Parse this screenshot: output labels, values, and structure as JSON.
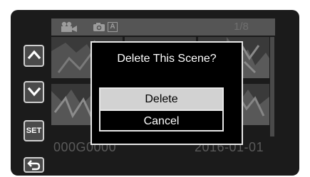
{
  "status_bar": {
    "mode_icons": [
      "video-camera-icon",
      "camera-icon"
    ],
    "auto_badge": "A",
    "page_counter": "1/8"
  },
  "side_buttons": {
    "set_label": "SET",
    "icons": [
      "chevron-up-icon",
      "chevron-down-icon",
      "back-arrow-icon"
    ]
  },
  "footer": {
    "file_name": "000G0000",
    "date": "2016-01-01"
  },
  "dialog": {
    "title": "Delete This Scene?",
    "options": [
      {
        "label": "Delete",
        "selected": true
      },
      {
        "label": "Cancel",
        "selected": false
      }
    ]
  },
  "colors": {
    "panel_bg": "#1b1b1b",
    "dialog_bg": "#000000",
    "selected_option_bg": "#d2d2d2",
    "button_bg": "#4a4a4a",
    "status_bar_bg": "#555555"
  }
}
